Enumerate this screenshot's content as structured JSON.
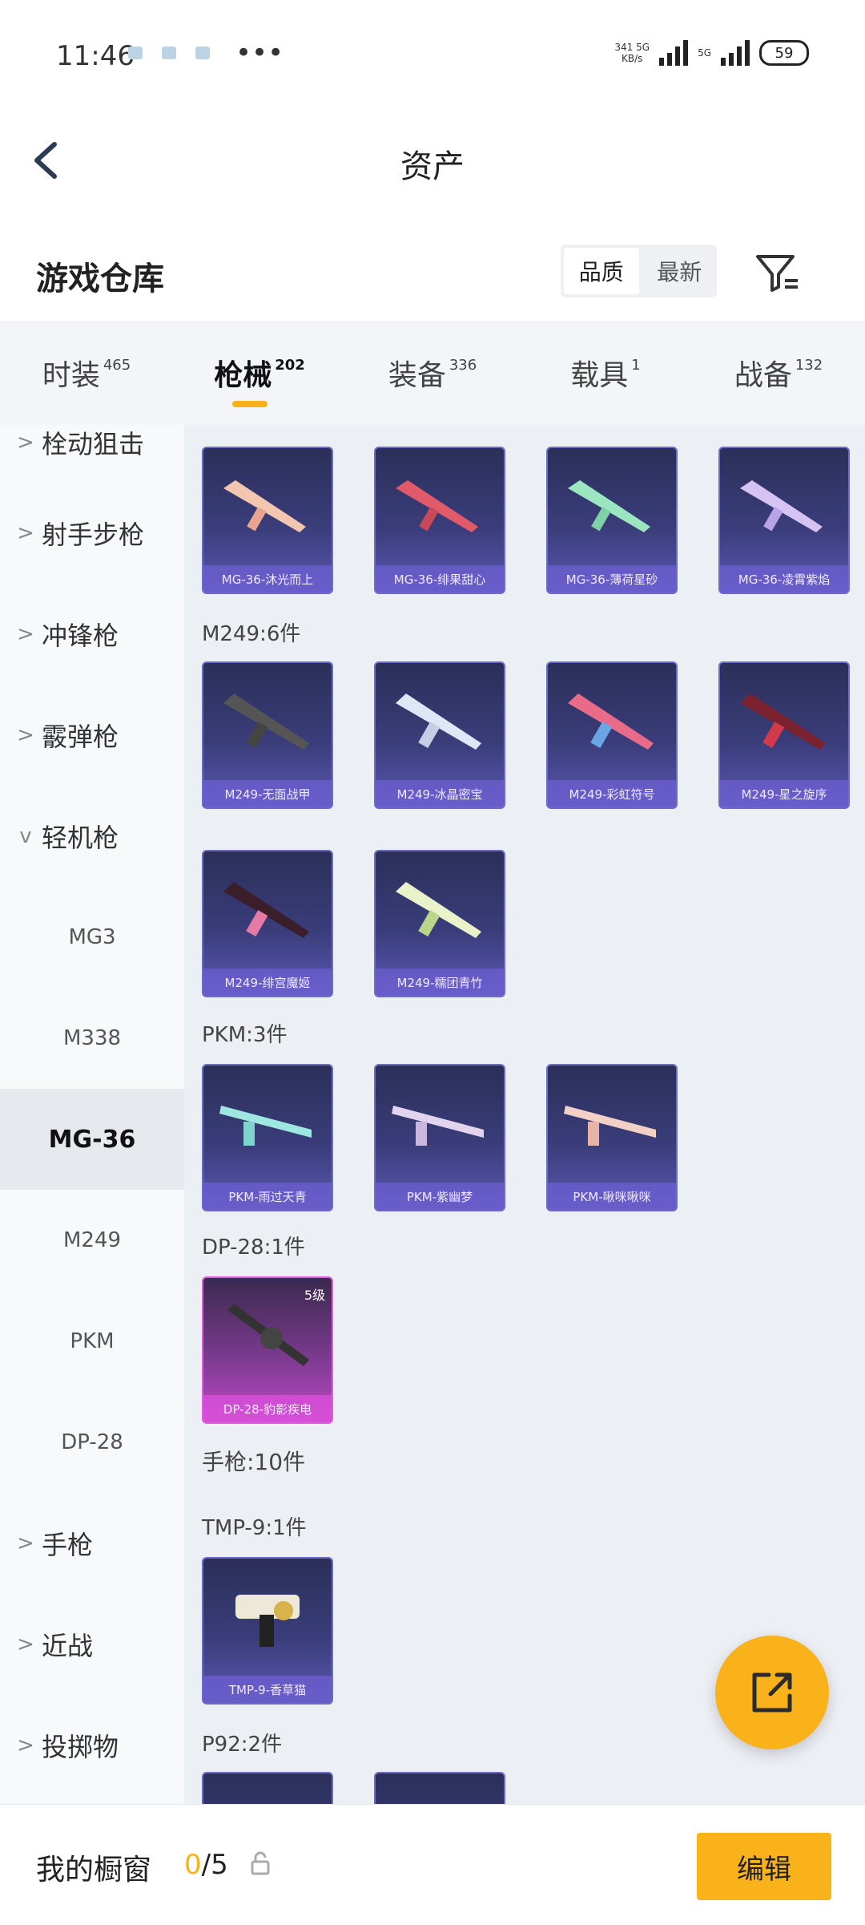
{
  "status": {
    "time": "11:46",
    "net_speed_top": "341 5G",
    "net_speed_bottom": "KB/s",
    "sim2": "5G",
    "battery": "59"
  },
  "header": {
    "title": "资产"
  },
  "titlebar": {
    "title": "游戏仓库",
    "sort_quality": "品质",
    "sort_newest": "最新"
  },
  "category_tabs": [
    {
      "label": "时装",
      "count": "465"
    },
    {
      "label": "枪械",
      "count": "202"
    },
    {
      "label": "装备",
      "count": "336"
    },
    {
      "label": "载具",
      "count": "1"
    },
    {
      "label": "战备",
      "count": "132"
    }
  ],
  "sidebar": {
    "items": [
      {
        "label": "栓动狙击"
      },
      {
        "label": "射手步枪"
      },
      {
        "label": "冲锋枪"
      },
      {
        "label": "霰弹枪"
      },
      {
        "label": "轻机枪"
      }
    ],
    "sub_items": [
      {
        "label": "MG3"
      },
      {
        "label": "M338"
      },
      {
        "label": "MG-36"
      },
      {
        "label": "M249"
      },
      {
        "label": "PKM"
      },
      {
        "label": "DP-28"
      }
    ],
    "items_after": [
      {
        "label": "手枪"
      },
      {
        "label": "近战"
      },
      {
        "label": "投掷物"
      }
    ]
  },
  "groups": {
    "mg36_cards": [
      {
        "name": "MG-36-沐光而上"
      },
      {
        "name": "MG-36-绯果甜心"
      },
      {
        "name": "MG-36-薄荷星砂"
      },
      {
        "name": "MG-36-凌霄紫焰"
      }
    ],
    "m249_title": "M249:6件",
    "m249_cards": [
      {
        "name": "M249-无面战甲"
      },
      {
        "name": "M249-冰晶密宝"
      },
      {
        "name": "M249-彩虹符号"
      },
      {
        "name": "M249-星之旋序"
      },
      {
        "name": "M249-绯宫魔姬"
      },
      {
        "name": "M249-糯团青竹"
      }
    ],
    "pkm_title": "PKM:3件",
    "pkm_cards": [
      {
        "name": "PKM-雨过天青"
      },
      {
        "name": "PKM-紫幽梦"
      },
      {
        "name": "PKM-啾咪啾咪"
      }
    ],
    "dp28_title": "DP-28:1件",
    "dp28_card": {
      "name": "DP-28-豹影疾电",
      "level": "5级"
    },
    "pistol_title": "手枪:10件",
    "tmp9_title": "TMP-9:1件",
    "tmp9_card": {
      "name": "TMP-9-香草猫"
    },
    "p92_title": "P92:2件"
  },
  "bottom": {
    "showcase_label": "我的橱窗",
    "count_current": "0",
    "count_total": "/5",
    "edit_label": "编辑"
  }
}
